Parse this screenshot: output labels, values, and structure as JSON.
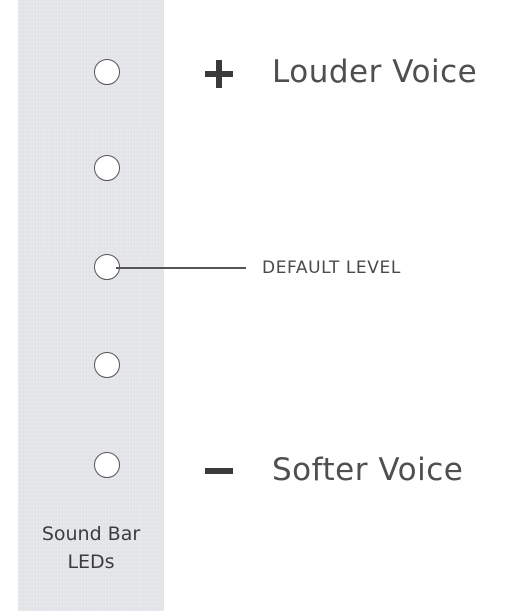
{
  "panel": {
    "caption_line1": "Sound Bar",
    "caption_line2": "LEDs",
    "background_color": "#e6e8ec",
    "led_count": 5
  },
  "labels": {
    "louder": "Louder Voice",
    "default": "DEFAULT LEVEL",
    "softer": "Softer Voice"
  },
  "symbols": {
    "plus_icon": "plus-icon",
    "minus_icon": "minus-icon"
  }
}
